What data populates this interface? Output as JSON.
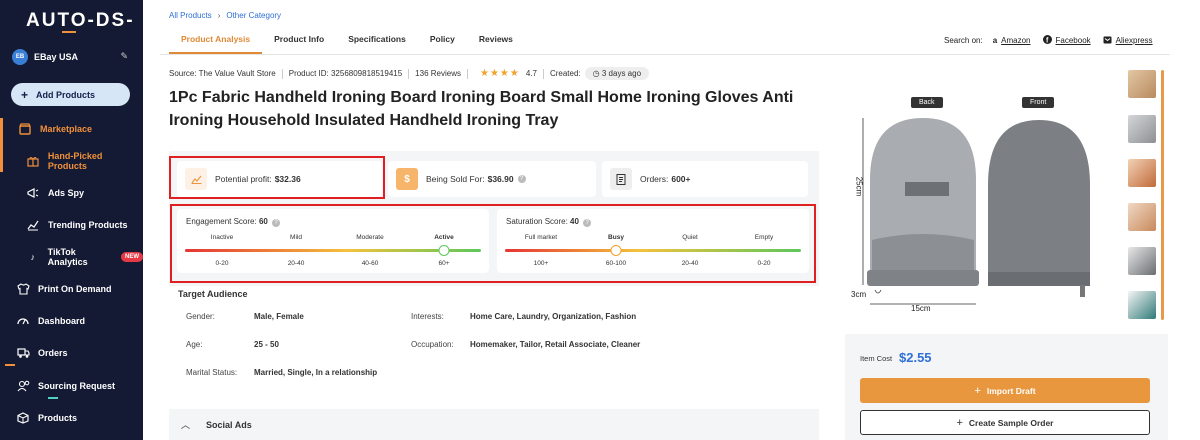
{
  "brand": {
    "logo": "AUTO-DS-"
  },
  "store": {
    "badge": "EB",
    "name": "EBay USA"
  },
  "sidebar": {
    "add_label": "Add Products",
    "items": [
      {
        "label": "Marketplace"
      },
      {
        "label": "Hand-Picked Products"
      },
      {
        "label": "Ads Spy"
      },
      {
        "label": "Trending Products"
      },
      {
        "label": "TikTok Analytics",
        "badge": "NEW"
      },
      {
        "label": "Print On Demand"
      },
      {
        "label": "Dashboard"
      },
      {
        "label": "Orders"
      },
      {
        "label": "Sourcing Request"
      },
      {
        "label": "Products"
      }
    ]
  },
  "breadcrumb": {
    "root": "All Products",
    "current": "Other Category"
  },
  "tabs": [
    {
      "label": "Product Analysis"
    },
    {
      "label": "Product Info"
    },
    {
      "label": "Specifications"
    },
    {
      "label": "Policy"
    },
    {
      "label": "Reviews"
    }
  ],
  "search_on": {
    "label": "Search on:",
    "amazon": "Amazon",
    "facebook": "Facebook",
    "aliexpress": "Aliexpress"
  },
  "meta": {
    "source": "Source: The Value Vault Store",
    "product_id": "Product ID: 3256809818519415",
    "reviews": "136 Reviews",
    "stars": "★★★★",
    "rating": "4.7",
    "created_label": "Created:",
    "created_value": "3 days ago"
  },
  "product": {
    "title": "1Pc Fabric Handheld Ironing Board Ironing Board Small Home Ironing Gloves Anti Ironing Household Insulated Handheld Ironing Tray"
  },
  "stats": {
    "profit_label": "Potential profit:",
    "profit_value": "$32.36",
    "sold_label": "Being Sold For:",
    "sold_value": "$36.90",
    "orders_label": "Orders:",
    "orders_value": "600+"
  },
  "engagement": {
    "label": "Engagement Score:",
    "value": "60",
    "score": 60,
    "levels": [
      "Inactive",
      "Mild",
      "Moderate",
      "Active"
    ],
    "ranges": [
      "0-20",
      "20-40",
      "40-60",
      "60+"
    ]
  },
  "saturation": {
    "label": "Saturation Score:",
    "value": "40",
    "score": 40,
    "levels": [
      "Full market",
      "Busy",
      "Quiet",
      "Empty"
    ],
    "ranges": [
      "100+",
      "60-100",
      "20-40",
      "0-20"
    ]
  },
  "audience": {
    "title": "Target Audience",
    "gender_label": "Gender:",
    "gender": "Male, Female",
    "age_label": "Age:",
    "age": "25 - 50",
    "marital_label": "Marital Status:",
    "marital": "Married, Single, In a relationship",
    "interests_label": "Interests:",
    "interests": "Home Care, Laundry, Organization, Fashion",
    "occupation_label": "Occupation:",
    "occupation": "Homemaker, Tailor, Retail Associate, Cleaner"
  },
  "social": {
    "label": "Social Ads"
  },
  "image": {
    "back_label": "Back",
    "front_label": "Front",
    "dim_height": "25cm",
    "dim_width": "15cm",
    "dim_small": "3cm"
  },
  "buy": {
    "cost_label": "Item Cost",
    "cost_value": "$2.55",
    "import_label": "Import Draft",
    "sample_label": "Create Sample Order"
  },
  "colors": {
    "sidebar_bg": "#141a33",
    "accent": "#e8973f",
    "link": "#2f6fd6",
    "highlight_border": "#e02020"
  }
}
